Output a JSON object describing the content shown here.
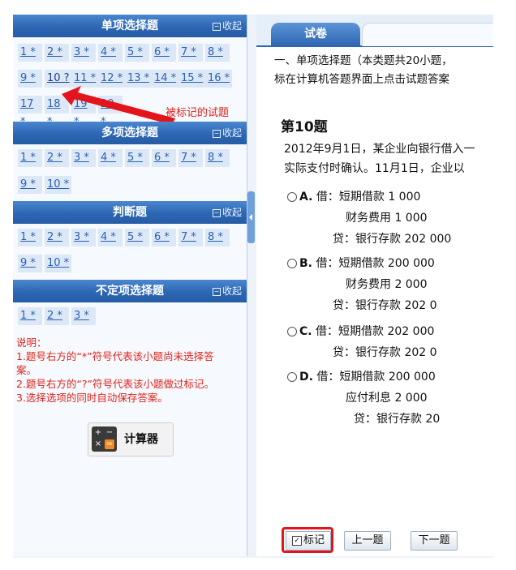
{
  "left_panel": {
    "sections": [
      {
        "title": "单项选择题",
        "collapse": "收起",
        "questions": [
          "1 *",
          "2 *",
          "3 *",
          "4 *",
          "5 *",
          "6 *",
          "7 *",
          "8 *",
          "9 *",
          "10 ?",
          "11 *",
          "12 *",
          "13 *",
          "14 *",
          "15 *",
          "16 *",
          "17 *",
          "18 *",
          "19 *",
          "20 *"
        ]
      },
      {
        "title": "多项选择题",
        "collapse": "收起",
        "questions": [
          "1 *",
          "2 *",
          "3 *",
          "4 *",
          "5 *",
          "6 *",
          "7 *",
          "8 *",
          "9 *",
          "10 *"
        ]
      },
      {
        "title": "判断题",
        "collapse": "收起",
        "questions": [
          "1 *",
          "2 *",
          "3 *",
          "4 *",
          "5 *",
          "6 *",
          "7 *",
          "8 *",
          "9 *",
          "10 *"
        ]
      },
      {
        "title": "不定项选择题",
        "collapse": "收起",
        "questions": [
          "1 *",
          "2 *",
          "3 *"
        ]
      }
    ],
    "annotation_label": "被标记的试题",
    "notes": [
      "说明：",
      "1.题号右方的“*”符号代表该小题尚未选择答",
      "案。",
      "2.题号右方的“?”符号代表该小题做过标记。",
      "3.选择选项的同时自动保存答案。"
    ],
    "calculator_label": "计算器",
    "calculator_keys": [
      "+",
      "−",
      "×",
      "="
    ]
  },
  "right_panel": {
    "tab_label": "试卷",
    "intro": [
      "一、单项选择题（本类题共20小题，",
      "标在计算机答题界面上点击试题答案"
    ],
    "question_title": "第10题",
    "stem": [
      "2012年9月1日，某企业向银行借入一",
      "实际支付时确认。11月1日，企业以"
    ],
    "options": [
      {
        "letter": "A.",
        "lines": [
          "借：短期借款   1 000",
          "财务费用   1 000",
          "贷：银行存款        202 000"
        ]
      },
      {
        "letter": "B.",
        "lines": [
          "借：短期借款   200 000",
          "财务费用    2 000",
          "贷：银行存款         202 0"
        ]
      },
      {
        "letter": "C.",
        "lines": [
          "借：短期借款   202 000",
          "贷：银行存款         202 0"
        ]
      },
      {
        "letter": "D.",
        "lines": [
          "借：短期借款      200 000",
          "应付利息       2 000",
          "贷：银行存款         20"
        ]
      }
    ],
    "buttons": {
      "mark": "标记",
      "prev": "上一题",
      "next": "下一题"
    }
  },
  "colors": {
    "header": "#2d66b3",
    "note": "#e0231c",
    "highlight": "#e4141b"
  }
}
